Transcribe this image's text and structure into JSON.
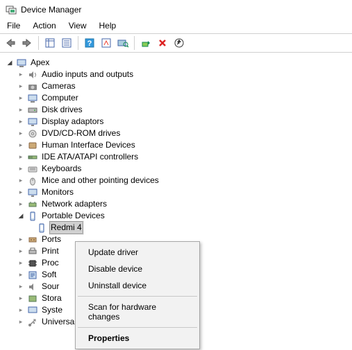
{
  "window": {
    "title": "Device Manager"
  },
  "menu": {
    "file": "File",
    "action": "Action",
    "view": "View",
    "help": "Help"
  },
  "tree": {
    "root": "Apex",
    "items": [
      "Audio inputs and outputs",
      "Cameras",
      "Computer",
      "Disk drives",
      "Display adaptors",
      "DVD/CD-ROM drives",
      "Human Interface Devices",
      "IDE ATA/ATAPI controllers",
      "Keyboards",
      "Mice and other pointing devices",
      "Monitors",
      "Network adapters",
      "Portable Devices",
      "Ports",
      "Print",
      "Proc",
      "Soft",
      "Sour",
      "Stora",
      "Syste",
      "Universal Serial Bus controllers"
    ],
    "expanded_child": "Redmi 4"
  },
  "context": {
    "update": "Update driver",
    "disable": "Disable device",
    "uninstall": "Uninstall device",
    "scan": "Scan for hardware changes",
    "properties": "Properties"
  }
}
